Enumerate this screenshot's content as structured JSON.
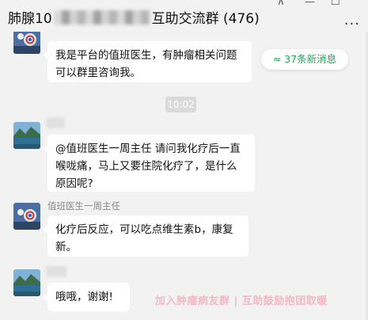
{
  "window": {
    "title_prefix": "肺腺10",
    "title_suffix": "互助交流群 (476)",
    "pin_glyph": "⊼",
    "min_glyph": "—",
    "max_glyph": "☐",
    "more_glyph": "···"
  },
  "chat": {
    "new_messages_badge": "≈ 37条新消息",
    "timestamp": "10:02",
    "messages": [
      {
        "sender": "",
        "text_lines": [
          "我是平台的值班医生，有肿瘤相关问题",
          "可以群里咨询我。"
        ]
      },
      {
        "sender": "",
        "text_lines": [
          "@值班医生一周主任 请问我化疗后一直",
          "喉咙痛，马上又要住院化疗了，是什么",
          "原因呢?"
        ]
      },
      {
        "sender": "值班医生一周主任",
        "text_lines": [
          "化疗后反应，可以吃点维生素b，康复",
          "新。"
        ]
      },
      {
        "sender": "",
        "text_lines": [
          "哦哦，谢谢!"
        ]
      }
    ],
    "watermark": "加入肿瘤病友群 | 互助鼓励抱团取暖"
  },
  "colors": {
    "background": "#f2f2f2",
    "bubble": "#ffffff",
    "new_message_green": "#21a558",
    "watermark_pink": "#f2b8c8"
  }
}
